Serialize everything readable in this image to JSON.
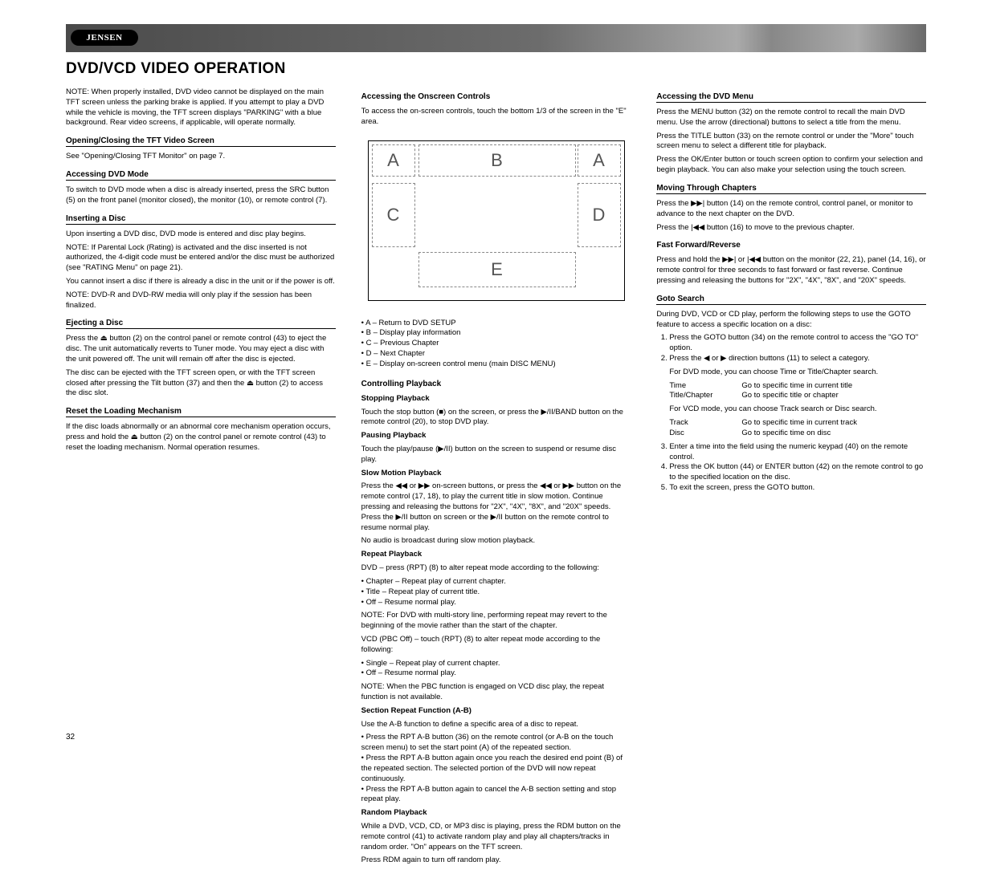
{
  "brand": "JENSEN",
  "header": {
    "title": "DVD/VCD VIDEO OPERATION"
  },
  "col1": {
    "note": "NOTE: When properly installed, DVD video cannot be displayed on the main TFT screen unless the parking brake is applied. If you attempt to play a DVD while the vehicle is moving, the TFT screen displays \"PARKING\" with a blue background. Rear video screens, if applicable, will operate normally.",
    "openingTitle": "Opening/Closing the TFT Video Screen",
    "openingBody": "See \"Opening/Closing TFT Monitor\" on page 7.",
    "accessTitle": "Accessing DVD Mode",
    "accessBody": "To switch to DVD mode when a disc is already inserted, press the SRC button (5) on the front panel (monitor closed), the monitor (10), or remote control (7).",
    "insertTitle": "Inserting a Disc",
    "insertBody": "Upon inserting a DVD disc, DVD mode is entered and disc play begins.",
    "insertNote": "NOTE: If Parental Lock (Rating) is activated and the disc inserted is not authorized, the 4-digit code must be entered and/or the disc must be authorized (see \"RATING Menu\" on page 21).",
    "insertTip": "You cannot insert a disc if there is already a disc in the unit or if the power is off.",
    "insertMp3Note": "NOTE: DVD-R and DVD-RW media will only play if the session has been finalized.",
    "ejectTitle": "Ejecting a Disc",
    "ejectBody1": "Press the ⏏ button (2) on the control panel or remote control (43) to eject the disc. The unit automatically reverts to Tuner mode. You may eject a disc with the unit powered off. The unit will remain off after the disc is ejected.",
    "ejectBody2": "The disc can be ejected with the TFT screen open, or with the TFT screen closed after pressing the Tilt button (37) and then the ⏏ button (2) to access the disc slot.",
    "resetTitle": "Reset the Loading Mechanism",
    "resetBody": "If the disc loads abnormally or an abnormal core mechanism operation occurs, press and hold the ⏏ button (2) on the control panel or remote control (43) to reset the loading mechanism. Normal operation resumes."
  },
  "col2": {
    "diagramTitle": "Accessing the Onscreen Controls",
    "diagramLead": "To access the on-screen controls, touch the bottom 1/3 of the screen in the \"E\" area.",
    "diagram": {
      "A": "A",
      "B": "B",
      "C": "C",
      "D": "D",
      "E": "E"
    },
    "legend": [
      "A – Return to DVD SETUP",
      "B – Display play information",
      "C – Previous Chapter",
      "D – Next Chapter",
      "E – Display on-screen control menu (main DISC MENU)"
    ],
    "playTitle": "Controlling Playback",
    "stopTitle": "Stopping Playback",
    "stopBody": "Touch the stop button (■) on the screen, or press the ▶/II/BAND button on the remote control (20), to stop DVD play.",
    "pauseTitle": "Pausing Playback",
    "pauseBody": "Touch the play/pause (▶/II) button on the screen to suspend or resume disc play.",
    "slowTitle": "Slow Motion Playback",
    "slowBody": "Press the ◀◀ or ▶▶ on-screen buttons, or press the ◀◀ or ▶▶ button on the remote control (17, 18), to play the current title in slow motion. Continue pressing and releasing the buttons for \"2X\", \"4X\", \"8X\", and \"20X\" speeds. Press the ▶/II button on screen or the ▶/II button on the remote control to resume normal play.",
    "slowNote": "No audio is broadcast during slow motion playback.",
    "repeatTitle": "Repeat Playback",
    "repeatDvd": "DVD – press (RPT) (8) to alter repeat mode according to the following:",
    "repeatDvdList": [
      "Chapter – Repeat play of current chapter.",
      "Title – Repeat play of current title.",
      "Off – Resume normal play."
    ],
    "repeatDvdNote": "NOTE: For DVD with multi-story line, performing repeat may revert to the beginning of the movie rather than the start of the chapter.",
    "repeatVcd": "VCD (PBC Off) – touch (RPT) (8) to alter repeat mode according to the following:",
    "repeatVcdList": [
      "Single – Repeat play of current chapter.",
      "Off – Resume normal play."
    ],
    "repeatVcdNote": "NOTE: When the PBC function is engaged on VCD disc play, the repeat function is not available.",
    "sectionTitle": "Section Repeat Function (A-B)",
    "sectionBody": "Use the A-B function to define a specific area of a disc to repeat.",
    "sectionList": [
      "Press the RPT A-B button (36) on the remote control (or A-B on the touch screen menu) to set the start point (A) of the repeated section.",
      "Press the RPT A-B button again once you reach the desired end point (B) of the repeated section. The selected portion of the DVD will now repeat continuously.",
      "Press the RPT A-B button again to cancel the A-B section setting and stop repeat play."
    ],
    "randomTitle": "Random Playback",
    "randomBody": "While a DVD, VCD, CD, or MP3 disc is playing, press the RDM button on the remote control (41) to activate random play and play all chapters/tracks in random order. \"On\" appears on the TFT screen.",
    "randomOff": "Press RDM again to turn off random play."
  },
  "col3": {
    "accessMenuTitle": "Accessing the DVD Menu",
    "accessMenuBody": "Press the MENU button (32) on the remote control to recall the main DVD menu. Use the arrow (directional) buttons to select a title from the menu.",
    "accessMenuBody2": "Press the TITLE button (33) on the remote control or under the \"More\" touch screen menu to select a different title for playback.",
    "accessMenuBody3": "Press the OK/Enter button or touch screen option to confirm your selection and begin playback. You can also make your selection using the touch screen.",
    "movingTitle": "Moving Through Chapters",
    "movingBody": "Press the ▶▶| button (14) on the remote control, control panel, or monitor to advance to the next chapter on the DVD.",
    "movingBody2": "Press the |◀◀ button (16) to move to the previous chapter.",
    "fastTitle": "Fast Forward/Reverse",
    "fastBody": "Press and hold the ▶▶| or |◀◀ button on the monitor (22, 21), panel (14, 16), or remote control for three seconds to fast forward or fast reverse. Continue pressing and releasing the buttons for \"2X\", \"4X\", \"8X\", and \"20X\" speeds.",
    "gotoTitle": "Goto Search",
    "gotoBody": "During DVD, VCD or CD play, perform the following steps to use the GOTO feature to access a specific location on a disc:",
    "gotoList": [
      "Press the GOTO button (34) on the remote control to access the \"GO TO\" option.",
      "Press the ◀ or ▶ direction buttons (11) to select a category."
    ],
    "gotoDvd": "For DVD mode, you can choose Time or Title/Chapter search.",
    "gotoDvdTableRows": [
      {
        "l": "Time",
        "r": "Go to specific time in current title"
      },
      {
        "l": "Title/Chapter",
        "r": "Go to specific title or chapter"
      }
    ],
    "gotoVcd": "For VCD mode, you can choose Track search or Disc search.",
    "gotoVcdTableRows": [
      {
        "l": "Track",
        "r": "Go to specific time in current track"
      },
      {
        "l": "Disc",
        "r": "Go to specific time on disc"
      }
    ],
    "gotoList2": [
      "Enter a time into the field using the numeric keypad (40) on the remote control.",
      "Press the OK button (44) or ENTER button (42) on the remote control to go to the specified location on the disc.",
      "To exit the screen, press the GOTO button."
    ]
  },
  "pageNumber": "32"
}
